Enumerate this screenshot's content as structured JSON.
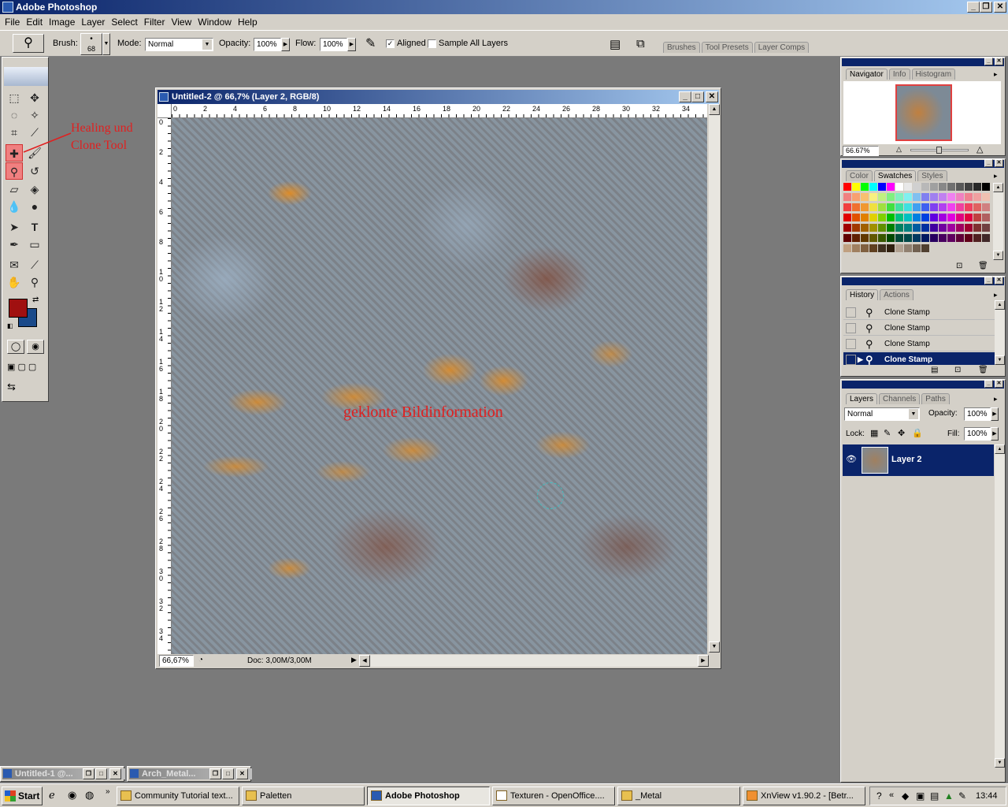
{
  "app": {
    "title": "Adobe Photoshop"
  },
  "menu": [
    "File",
    "Edit",
    "Image",
    "Layer",
    "Select",
    "Filter",
    "View",
    "Window",
    "Help"
  ],
  "options": {
    "brush_label": "Brush:",
    "brush_size": "68",
    "mode_label": "Mode:",
    "mode_value": "Normal",
    "opacity_label": "Opacity:",
    "opacity_value": "100%",
    "flow_label": "Flow:",
    "flow_value": "100%",
    "aligned_label": "Aligned",
    "aligned_checked": true,
    "sample_all_label": "Sample All Layers",
    "sample_all_checked": false,
    "well_tabs": [
      "Brushes",
      "Tool Presets",
      "Layer Comps"
    ]
  },
  "annotations": {
    "tool_note_line1": "Healing und",
    "tool_note_line2": "Clone Tool",
    "canvas_note": "geklonte Bildinformation",
    "color": "#e02020"
  },
  "document": {
    "title": "Untitled-2 @ 66,7% (Layer 2, RGB/8)",
    "zoom": "66,67%",
    "doc_info": "Doc: 3,00M/3,00M",
    "ruler_h": [
      "0",
      "2",
      "4",
      "6",
      "8",
      "10",
      "12",
      "14",
      "16",
      "18",
      "20",
      "22",
      "24",
      "26",
      "28",
      "30",
      "32",
      "34"
    ],
    "ruler_v": [
      "0",
      "2",
      "4",
      "6",
      "8",
      "1 0",
      "1 2",
      "1 4",
      "1 6",
      "1 8",
      "2 0",
      "2 2",
      "2 4",
      "2 6",
      "2 8",
      "3 0",
      "3 2",
      "3 4"
    ]
  },
  "colors": {
    "foreground": "#a01010",
    "background": "#1a4a8a"
  },
  "navigator": {
    "tabs": [
      "Navigator",
      "Info",
      "Histogram"
    ],
    "zoom": "66.67%"
  },
  "swatches": {
    "tabs": [
      "Color",
      "Swatches",
      "Styles"
    ],
    "rows": [
      [
        "#ff0000",
        "#ffff00",
        "#00ff00",
        "#00ffff",
        "#0000ff",
        "#ff00ff",
        "#ffffff",
        "#e8e8e8",
        "#d0d0d0",
        "#b8b8b8",
        "#a0a0a0",
        "#888888",
        "#707070",
        "#585858",
        "#404040",
        "#282828",
        "#000000"
      ],
      [
        "#f08080",
        "#f8a070",
        "#f8c070",
        "#f8f080",
        "#c0f080",
        "#80f080",
        "#80f0c0",
        "#80f0f0",
        "#80c0f0",
        "#8080f0",
        "#a080f0",
        "#c080f0",
        "#f080f0",
        "#f080c0",
        "#f08090",
        "#f0a0a0",
        "#f0c0b0"
      ],
      [
        "#f04040",
        "#f07030",
        "#f09830",
        "#f0e040",
        "#a0e040",
        "#40e040",
        "#40e0a0",
        "#40e0e0",
        "#40a0f0",
        "#4060f0",
        "#8040f0",
        "#b040f0",
        "#f040f0",
        "#f040a0",
        "#f04060",
        "#e06060",
        "#d08080"
      ],
      [
        "#e00000",
        "#e05000",
        "#e08000",
        "#e0d000",
        "#80d000",
        "#00c000",
        "#00c080",
        "#00c0c0",
        "#0080e0",
        "#0040e0",
        "#6000e0",
        "#a000e0",
        "#e000e0",
        "#e00080",
        "#e00040",
        "#c04040",
        "#b06060"
      ],
      [
        "#a00000",
        "#a03800",
        "#a06000",
        "#a09000",
        "#609000",
        "#008000",
        "#008060",
        "#008080",
        "#005ca0",
        "#0030a0",
        "#4000a0",
        "#7000a0",
        "#a000a0",
        "#a00060",
        "#a00030",
        "#803030",
        "#704040"
      ],
      [
        "#600000",
        "#602000",
        "#603800",
        "#605800",
        "#385800",
        "#004800",
        "#004838",
        "#004848",
        "#003860",
        "#001860",
        "#280060",
        "#480060",
        "#600060",
        "#600038",
        "#600018",
        "#502020",
        "#402828"
      ],
      [
        "#c0a080",
        "#a08060",
        "#806040",
        "#604020",
        "#403020",
        "#302010",
        "#b0a090",
        "#908070",
        "#706050",
        "#504030",
        "",
        "",
        "",
        "",
        "",
        "",
        ""
      ]
    ]
  },
  "history": {
    "tabs": [
      "History",
      "Actions"
    ],
    "items": [
      "Clone Stamp",
      "Clone Stamp",
      "Clone Stamp",
      "Clone Stamp"
    ]
  },
  "layers": {
    "tabs": [
      "Layers",
      "Channels",
      "Paths"
    ],
    "blend_mode": "Normal",
    "opacity_label": "Opacity:",
    "opacity": "100%",
    "lock_label": "Lock:",
    "fill_label": "Fill:",
    "fill": "100%",
    "items": [
      {
        "name": "Layer 2",
        "visible": true
      }
    ]
  },
  "minimized": [
    {
      "title": "Untitled-1 @..."
    },
    {
      "title": "Arch_Metal..."
    }
  ],
  "taskbar": {
    "start": "Start",
    "buttons": [
      {
        "label": "Community Tutorial text...",
        "active": false
      },
      {
        "label": "Paletten",
        "active": false
      },
      {
        "label": "Adobe Photoshop",
        "active": true
      },
      {
        "label": "Texturen - OpenOffice....",
        "active": false
      },
      {
        "label": "_Metal",
        "active": false
      },
      {
        "label": "XnView v1.90.2 - [Betr...",
        "active": false
      }
    ],
    "clock": "13:44"
  }
}
